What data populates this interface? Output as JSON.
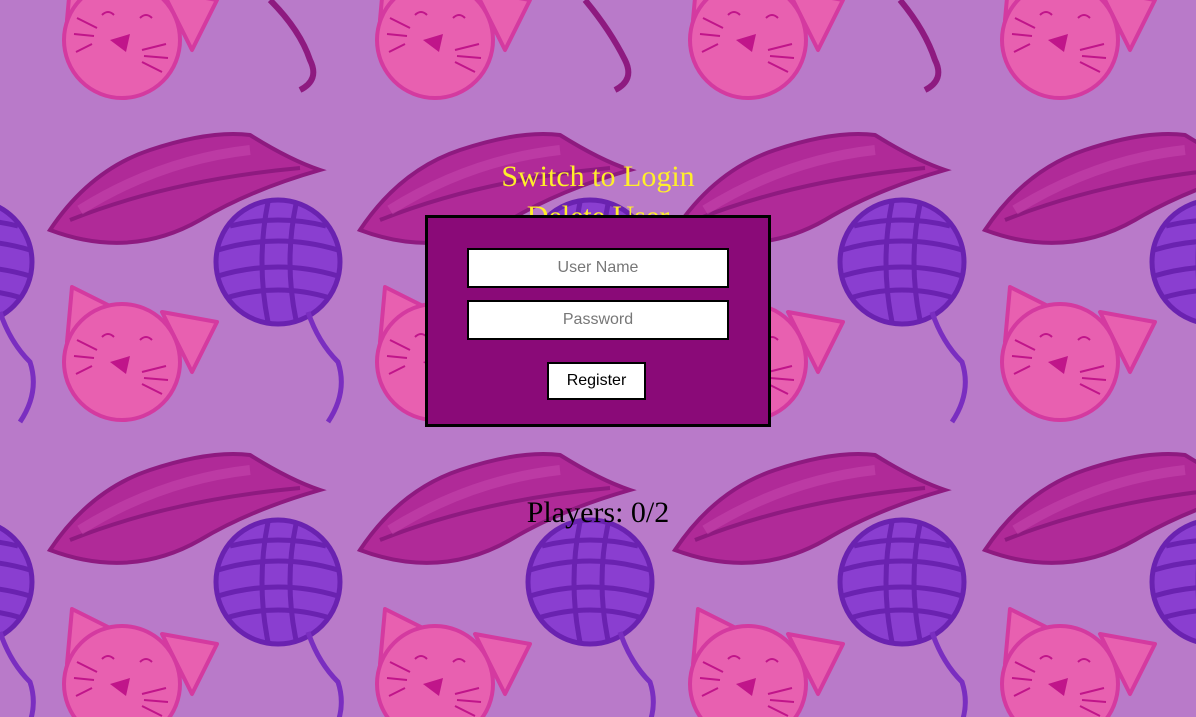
{
  "links": {
    "switch_label": "Switch to Login",
    "delete_label": "Delete User"
  },
  "form": {
    "username_placeholder": "User Name",
    "username_value": "",
    "password_placeholder": "Password",
    "password_value": "",
    "submit_label": "Register"
  },
  "status": {
    "players_text": "Players: 0/2"
  },
  "background": {
    "pattern_icons": [
      "cat-face-icon",
      "yarn-ball-icon",
      "leaf-icon"
    ]
  },
  "colors": {
    "page_background": "#b97ac9",
    "form_background": "#8a0a78",
    "link_color": "#ffef2a",
    "cat_color": "#e860b0",
    "yarn_color": "#8a3ed0",
    "leaf_color": "#b02a98"
  }
}
